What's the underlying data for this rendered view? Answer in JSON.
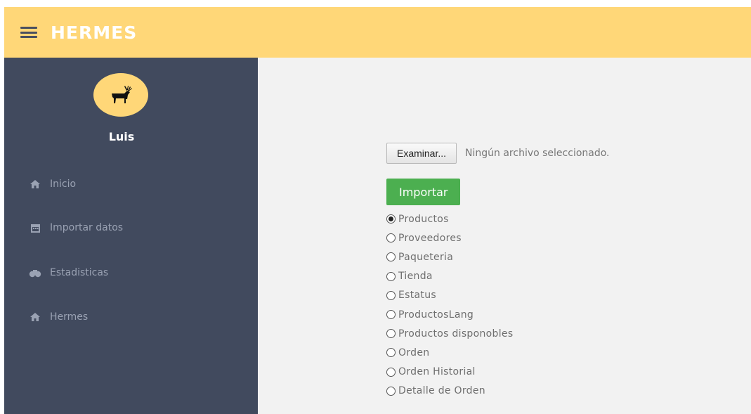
{
  "header": {
    "title": "HERMES",
    "menu_icon": "hamburger-menu-icon",
    "color": "#ffd778"
  },
  "sidebar": {
    "bg": "#414a5e",
    "user": {
      "name": "Luis",
      "avatar_icon": "deer-icon"
    },
    "items": [
      {
        "label": "Inicio",
        "icon": "home-icon"
      },
      {
        "label": "Importar datos",
        "icon": "calendar-icon"
      },
      {
        "label": "Estadisticas",
        "icon": "tachometer-icon"
      },
      {
        "label": "Hermes",
        "icon": "home-icon"
      }
    ]
  },
  "main": {
    "file": {
      "button_label": "Examinar...",
      "status": "Ningún archivo seleccionado."
    },
    "import_label": "Importar",
    "import_color": "#4caf50",
    "options": [
      {
        "label": "Productos",
        "selected": true
      },
      {
        "label": "Proveedores",
        "selected": false
      },
      {
        "label": "Paqueteria",
        "selected": false
      },
      {
        "label": "Tienda",
        "selected": false
      },
      {
        "label": "Estatus",
        "selected": false
      },
      {
        "label": "ProductosLang",
        "selected": false
      },
      {
        "label": "Productos disponobles",
        "selected": false
      },
      {
        "label": "Orden",
        "selected": false
      },
      {
        "label": "Orden Historial",
        "selected": false
      },
      {
        "label": "Detalle de Orden",
        "selected": false
      }
    ]
  }
}
